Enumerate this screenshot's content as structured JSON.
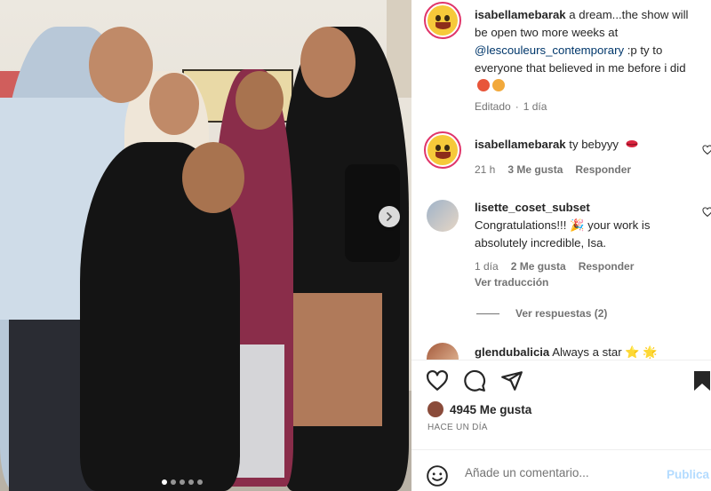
{
  "post": {
    "image_alt": "",
    "carousel": {
      "total": 5,
      "active_index": 0
    }
  },
  "caption": {
    "username": "isabellamebarak",
    "text_before": " a dream...the show will be open two more weeks at ",
    "mention": "@lescouleurs_contemporary",
    "text_after": " :p ty to everyone that believed in me before i did ",
    "edited_label": "Editado",
    "separator": "·",
    "time": "1 día"
  },
  "comments": [
    {
      "username": "isabellamebarak",
      "text": " ty bebyyy ",
      "time": "21 h",
      "likes": "3 Me gusta",
      "reply_label": "Responder"
    },
    {
      "username": "lisette_coset_subset",
      "text": " Congratulations!!! 🎉 your work is absolutely incredible, Isa.",
      "time": "1 día",
      "likes": "2 Me gusta",
      "reply_label": "Responder",
      "translate_label": "Ver traducción",
      "view_replies_label": "Ver respuestas (2)"
    },
    {
      "username": "glendubalicia",
      "text": " Always a star ⭐ 🌟"
    }
  ],
  "footer": {
    "likes_count": "4945 Me gusta",
    "time_ago": "HACE UN DÍA",
    "comment_placeholder": "Añade un comentario...",
    "publish_label": "Publica"
  },
  "icons": {
    "heart": "heart-icon",
    "comment": "comment-icon",
    "share": "share-icon",
    "bookmark": "bookmark-icon",
    "emoji": "emoji-icon",
    "next": "chevron-right-icon"
  },
  "colors": {
    "link": "#00376b",
    "muted": "#737373",
    "story_ring": "#e0356a",
    "publish_disabled": "#b3dbff"
  }
}
